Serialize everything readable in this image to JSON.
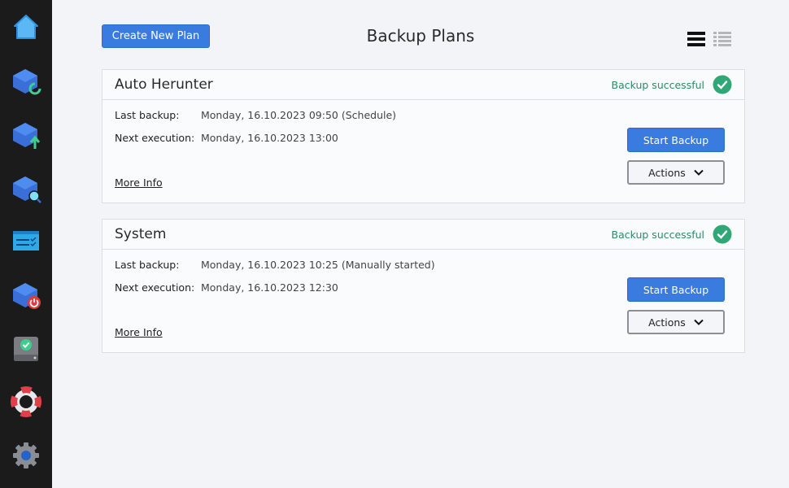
{
  "sidebar": {
    "items": [
      {
        "id": "home",
        "icon": "home-icon"
      },
      {
        "id": "restore",
        "icon": "restore-icon"
      },
      {
        "id": "backup",
        "icon": "backup-upload-icon"
      },
      {
        "id": "browse",
        "icon": "search-backup-icon"
      },
      {
        "id": "tasks",
        "icon": "task-list-icon"
      },
      {
        "id": "shutdown",
        "icon": "shutdown-backup-icon"
      },
      {
        "id": "drive",
        "icon": "drive-check-icon"
      },
      {
        "id": "help",
        "icon": "lifebuoy-icon"
      },
      {
        "id": "settings",
        "icon": "gear-icon"
      }
    ]
  },
  "header": {
    "create_label": "Create New Plan",
    "title": "Backup Plans"
  },
  "colors": {
    "accent": "#3a7be0",
    "success": "#2e8b64",
    "sidebar_bg": "#1c1b1c"
  },
  "plans": [
    {
      "name": "Auto Herunter",
      "status": "Backup successful",
      "last_backup_label": "Last backup:",
      "last_backup_value": "Monday, 16.10.2023 09:50 (Schedule)",
      "next_execution_label": "Next execution:",
      "next_execution_value": "Monday, 16.10.2023 13:00",
      "more_info": "More Info",
      "start_label": "Start Backup",
      "actions_label": "Actions"
    },
    {
      "name": "System",
      "status": "Backup successful",
      "last_backup_label": "Last backup:",
      "last_backup_value": "Monday, 16.10.2023 10:25 (Manually started)",
      "next_execution_label": "Next execution:",
      "next_execution_value": "Monday, 16.10.2023 12:30",
      "more_info": "More Info",
      "start_label": "Start Backup",
      "actions_label": "Actions"
    }
  ]
}
